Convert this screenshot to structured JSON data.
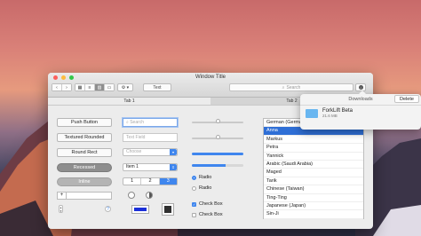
{
  "window": {
    "title": "Window Title"
  },
  "toolbar": {
    "back_glyph": "‹",
    "forward_glyph": "›",
    "view_icons": [
      "grid-icon",
      "list-icon",
      "columns-icon",
      "coverflow-icon"
    ],
    "action_label": "⚙ ▾",
    "text_button": "Text",
    "search_placeholder": "Search",
    "download_glyph": "↓"
  },
  "tabs": [
    {
      "label": "Tab 1",
      "active": true
    },
    {
      "label": "Tab 2",
      "active": false
    }
  ],
  "buttons": {
    "push": "Push Button",
    "textured": "Textured Rounded",
    "round_rect": "Round Rect",
    "recessed": "Recessed",
    "inline": "Inline",
    "plus": "+",
    "help": "?"
  },
  "fields": {
    "search_placeholder": "Search",
    "text_placeholder": "Text Field",
    "combo_placeholder": "Choose",
    "popup_value": "Item 1"
  },
  "segmented": {
    "items": [
      "1",
      "2",
      "3"
    ],
    "selected": 2
  },
  "sliders": {
    "slider1": 0.5,
    "slider2": 0.5
  },
  "progress": {
    "bar1": 1.0,
    "bar2": 0.65
  },
  "radios": [
    {
      "label": "Radio",
      "checked": true
    },
    {
      "label": "Radio",
      "checked": false
    }
  ],
  "checkboxes": [
    {
      "label": "Check Box",
      "checked": true
    },
    {
      "label": "Check Box",
      "checked": false
    }
  ],
  "colors": {
    "accent": "#3f86ee",
    "color_well": "#1a2fd8"
  },
  "list": {
    "items": [
      {
        "text": "German (Germany)",
        "type": "group"
      },
      {
        "text": "Anna",
        "type": "selected"
      },
      {
        "text": "Markus",
        "type": "item"
      },
      {
        "text": "Petra",
        "type": "item"
      },
      {
        "text": "Yannick",
        "type": "item"
      },
      {
        "text": "Arabic (Saudi Arabia)",
        "type": "group"
      },
      {
        "text": "Maged",
        "type": "item"
      },
      {
        "text": "Tarik",
        "type": "item"
      },
      {
        "text": "Chinese (Taiwan)",
        "type": "group"
      },
      {
        "text": "Ting-Ting",
        "type": "item"
      },
      {
        "text": "Japanese (Japan)",
        "type": "group"
      },
      {
        "text": "Sin-Ji",
        "type": "item"
      }
    ]
  },
  "downloads": {
    "title": "Downloads",
    "delete_label": "Delete",
    "item_name": "ForkLift Beta",
    "item_size": "21.6 MB"
  }
}
